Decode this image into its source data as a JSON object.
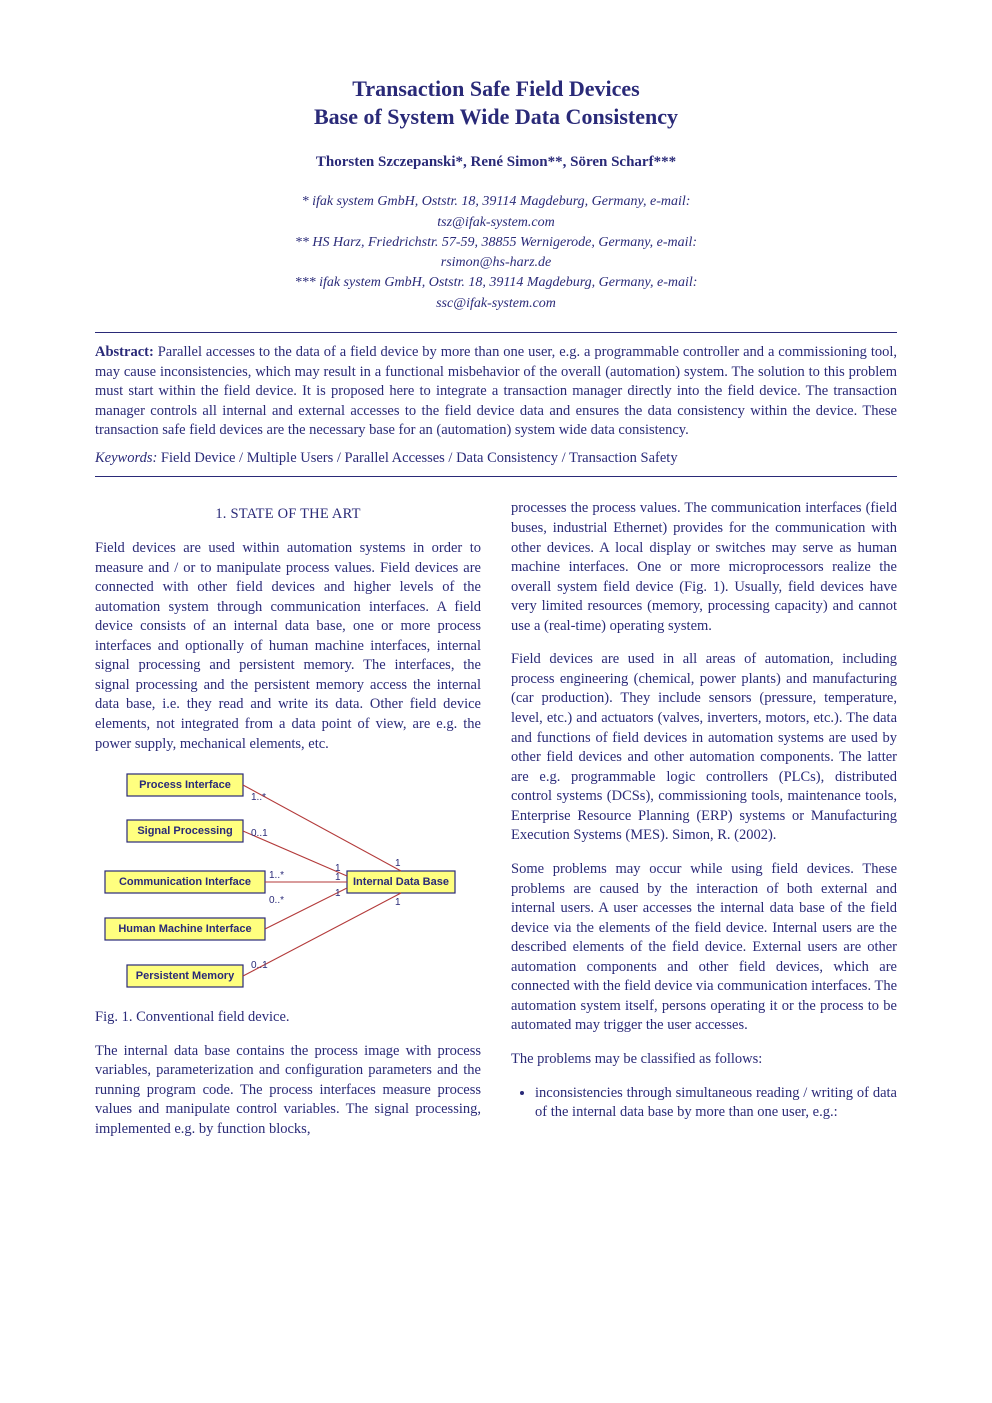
{
  "title": {
    "line1": "Transaction Safe Field Devices",
    "line2": "Base of System Wide Data Consistency"
  },
  "authors": "Thorsten Szczepanski*, René Simon**, Sören Scharf***",
  "affiliations": {
    "a1_line1": "* ifak system GmbH, Oststr. 18, 39114 Magdeburg, Germany, e-mail:",
    "a1_line2": "tsz@ifak-system.com",
    "a2_line1": "** HS Harz, Friedrichstr. 57-59, 38855 Wernigerode, Germany, e-mail:",
    "a2_line2": "rsimon@hs-harz.de",
    "a3_line1": "*** ifak system GmbH, Oststr. 18, 39114 Magdeburg, Germany, e-mail:",
    "a3_line2": "ssc@ifak-system.com"
  },
  "abstract": {
    "label": "Abstract:",
    "text": " Parallel accesses to the data of a field device by more than one user, e.g. a programmable controller and a commissioning tool, may cause inconsistencies, which may result in a functional misbehavior of the overall (automation) system. The solution to this problem must start within the field device. It is proposed here to integrate a transaction manager directly into the field device. The transaction manager controls all internal and external accesses to the field device data and ensures the data consistency within the device. These transaction safe field devices are the necessary base for an (automation) system wide data consistency."
  },
  "keywords": {
    "label": "Keywords:",
    "text": " Field Device / Multiple Users / Parallel Accesses / Data Consistency / Transaction Safety"
  },
  "section1_heading": "1. STATE OF THE ART",
  "col_left": {
    "p1": "Field devices are used within automation systems in order to measure and / or to manipulate process values. Field devices are connected with other field devices and higher levels of the automation system through communication interfaces. A field device consists of an internal data base, one or more process interfaces and optionally of human machine interfaces, internal signal processing and persistent memory. The interfaces, the signal processing and the persistent memory access the internal data base, i.e. they read and write its data. Other field device elements, not integrated from a data point of view, are e.g. the power supply, mechanical elements, etc.",
    "fig_caption": "Fig. 1. Conventional field device.",
    "p2": "The internal data base contains the process image with process variables, parameterization and configuration parameters and the running program code. The process interfaces measure process values and manipulate control variables. The signal processing, implemented e.g. by function blocks,"
  },
  "col_right": {
    "p1": "processes the process values. The communication interfaces (field buses, industrial Ethernet) provides for the communication with other devices. A local display or switches may serve as human machine interfaces. One or more microprocessors realize the overall system field device (Fig. 1). Usually, field devices have very limited resources (memory, processing capacity) and cannot use a (real-time) operating system.",
    "p2": "Field devices are used in all areas of automation, including process engineering (chemical, power plants) and manufacturing (car production). They include sensors (pressure, temperature, level, etc.) and actuators (valves, inverters, motors, etc.). The data and functions of field devices in automation systems are used by other field devices and other automation components. The latter are e.g. programmable logic controllers (PLCs), distributed control systems (DCSs), commissioning tools, maintenance tools, Enterprise Resource Planning (ERP) systems or Manufacturing Execution Systems (MES). Simon, R. (2002).",
    "p3": "Some problems may occur while using field devices. These problems are caused by the interaction of both external and internal users. A user accesses the internal data base of the field device via the elements of the field device. Internal users are the described elements of the field device. External users are other automation components and other field devices, which are connected with the field device via communication interfaces. The automation system itself, persons operating it or the process to be automated may trigger the user accesses.",
    "p4": "The problems may be classified as follows:",
    "bullet1": "inconsistencies through simultaneous reading / writing of data of the internal data base by more than one user, e.g.:"
  },
  "figure": {
    "boxes": {
      "process_interface": "Process Interface",
      "signal_processing": "Signal Processing",
      "communication_interface": "Communication Interface",
      "human_machine_interface": "Human Machine Interface",
      "persistent_memory": "Persistent Memory",
      "internal_data_base": "Internal Data Base"
    },
    "card": {
      "one_star": "1..*",
      "zero_one": "0..1",
      "zero_star": "0..*",
      "one": "1"
    }
  }
}
